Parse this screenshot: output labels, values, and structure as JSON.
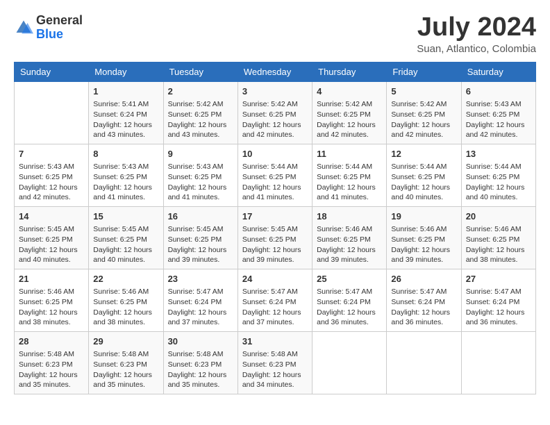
{
  "header": {
    "logo_line1": "General",
    "logo_line2": "Blue",
    "month_year": "July 2024",
    "location": "Suan, Atlantico, Colombia"
  },
  "days_of_week": [
    "Sunday",
    "Monday",
    "Tuesday",
    "Wednesday",
    "Thursday",
    "Friday",
    "Saturday"
  ],
  "weeks": [
    [
      {
        "day": "",
        "content": ""
      },
      {
        "day": "1",
        "content": "Sunrise: 5:41 AM\nSunset: 6:24 PM\nDaylight: 12 hours\nand 43 minutes."
      },
      {
        "day": "2",
        "content": "Sunrise: 5:42 AM\nSunset: 6:25 PM\nDaylight: 12 hours\nand 43 minutes."
      },
      {
        "day": "3",
        "content": "Sunrise: 5:42 AM\nSunset: 6:25 PM\nDaylight: 12 hours\nand 42 minutes."
      },
      {
        "day": "4",
        "content": "Sunrise: 5:42 AM\nSunset: 6:25 PM\nDaylight: 12 hours\nand 42 minutes."
      },
      {
        "day": "5",
        "content": "Sunrise: 5:42 AM\nSunset: 6:25 PM\nDaylight: 12 hours\nand 42 minutes."
      },
      {
        "day": "6",
        "content": "Sunrise: 5:43 AM\nSunset: 6:25 PM\nDaylight: 12 hours\nand 42 minutes."
      }
    ],
    [
      {
        "day": "7",
        "content": "Sunrise: 5:43 AM\nSunset: 6:25 PM\nDaylight: 12 hours\nand 42 minutes."
      },
      {
        "day": "8",
        "content": "Sunrise: 5:43 AM\nSunset: 6:25 PM\nDaylight: 12 hours\nand 41 minutes."
      },
      {
        "day": "9",
        "content": "Sunrise: 5:43 AM\nSunset: 6:25 PM\nDaylight: 12 hours\nand 41 minutes."
      },
      {
        "day": "10",
        "content": "Sunrise: 5:44 AM\nSunset: 6:25 PM\nDaylight: 12 hours\nand 41 minutes."
      },
      {
        "day": "11",
        "content": "Sunrise: 5:44 AM\nSunset: 6:25 PM\nDaylight: 12 hours\nand 41 minutes."
      },
      {
        "day": "12",
        "content": "Sunrise: 5:44 AM\nSunset: 6:25 PM\nDaylight: 12 hours\nand 40 minutes."
      },
      {
        "day": "13",
        "content": "Sunrise: 5:44 AM\nSunset: 6:25 PM\nDaylight: 12 hours\nand 40 minutes."
      }
    ],
    [
      {
        "day": "14",
        "content": "Sunrise: 5:45 AM\nSunset: 6:25 PM\nDaylight: 12 hours\nand 40 minutes."
      },
      {
        "day": "15",
        "content": "Sunrise: 5:45 AM\nSunset: 6:25 PM\nDaylight: 12 hours\nand 40 minutes."
      },
      {
        "day": "16",
        "content": "Sunrise: 5:45 AM\nSunset: 6:25 PM\nDaylight: 12 hours\nand 39 minutes."
      },
      {
        "day": "17",
        "content": "Sunrise: 5:45 AM\nSunset: 6:25 PM\nDaylight: 12 hours\nand 39 minutes."
      },
      {
        "day": "18",
        "content": "Sunrise: 5:46 AM\nSunset: 6:25 PM\nDaylight: 12 hours\nand 39 minutes."
      },
      {
        "day": "19",
        "content": "Sunrise: 5:46 AM\nSunset: 6:25 PM\nDaylight: 12 hours\nand 39 minutes."
      },
      {
        "day": "20",
        "content": "Sunrise: 5:46 AM\nSunset: 6:25 PM\nDaylight: 12 hours\nand 38 minutes."
      }
    ],
    [
      {
        "day": "21",
        "content": "Sunrise: 5:46 AM\nSunset: 6:25 PM\nDaylight: 12 hours\nand 38 minutes."
      },
      {
        "day": "22",
        "content": "Sunrise: 5:46 AM\nSunset: 6:25 PM\nDaylight: 12 hours\nand 38 minutes."
      },
      {
        "day": "23",
        "content": "Sunrise: 5:47 AM\nSunset: 6:24 PM\nDaylight: 12 hours\nand 37 minutes."
      },
      {
        "day": "24",
        "content": "Sunrise: 5:47 AM\nSunset: 6:24 PM\nDaylight: 12 hours\nand 37 minutes."
      },
      {
        "day": "25",
        "content": "Sunrise: 5:47 AM\nSunset: 6:24 PM\nDaylight: 12 hours\nand 36 minutes."
      },
      {
        "day": "26",
        "content": "Sunrise: 5:47 AM\nSunset: 6:24 PM\nDaylight: 12 hours\nand 36 minutes."
      },
      {
        "day": "27",
        "content": "Sunrise: 5:47 AM\nSunset: 6:24 PM\nDaylight: 12 hours\nand 36 minutes."
      }
    ],
    [
      {
        "day": "28",
        "content": "Sunrise: 5:48 AM\nSunset: 6:23 PM\nDaylight: 12 hours\nand 35 minutes."
      },
      {
        "day": "29",
        "content": "Sunrise: 5:48 AM\nSunset: 6:23 PM\nDaylight: 12 hours\nand 35 minutes."
      },
      {
        "day": "30",
        "content": "Sunrise: 5:48 AM\nSunset: 6:23 PM\nDaylight: 12 hours\nand 35 minutes."
      },
      {
        "day": "31",
        "content": "Sunrise: 5:48 AM\nSunset: 6:23 PM\nDaylight: 12 hours\nand 34 minutes."
      },
      {
        "day": "",
        "content": ""
      },
      {
        "day": "",
        "content": ""
      },
      {
        "day": "",
        "content": ""
      }
    ]
  ]
}
